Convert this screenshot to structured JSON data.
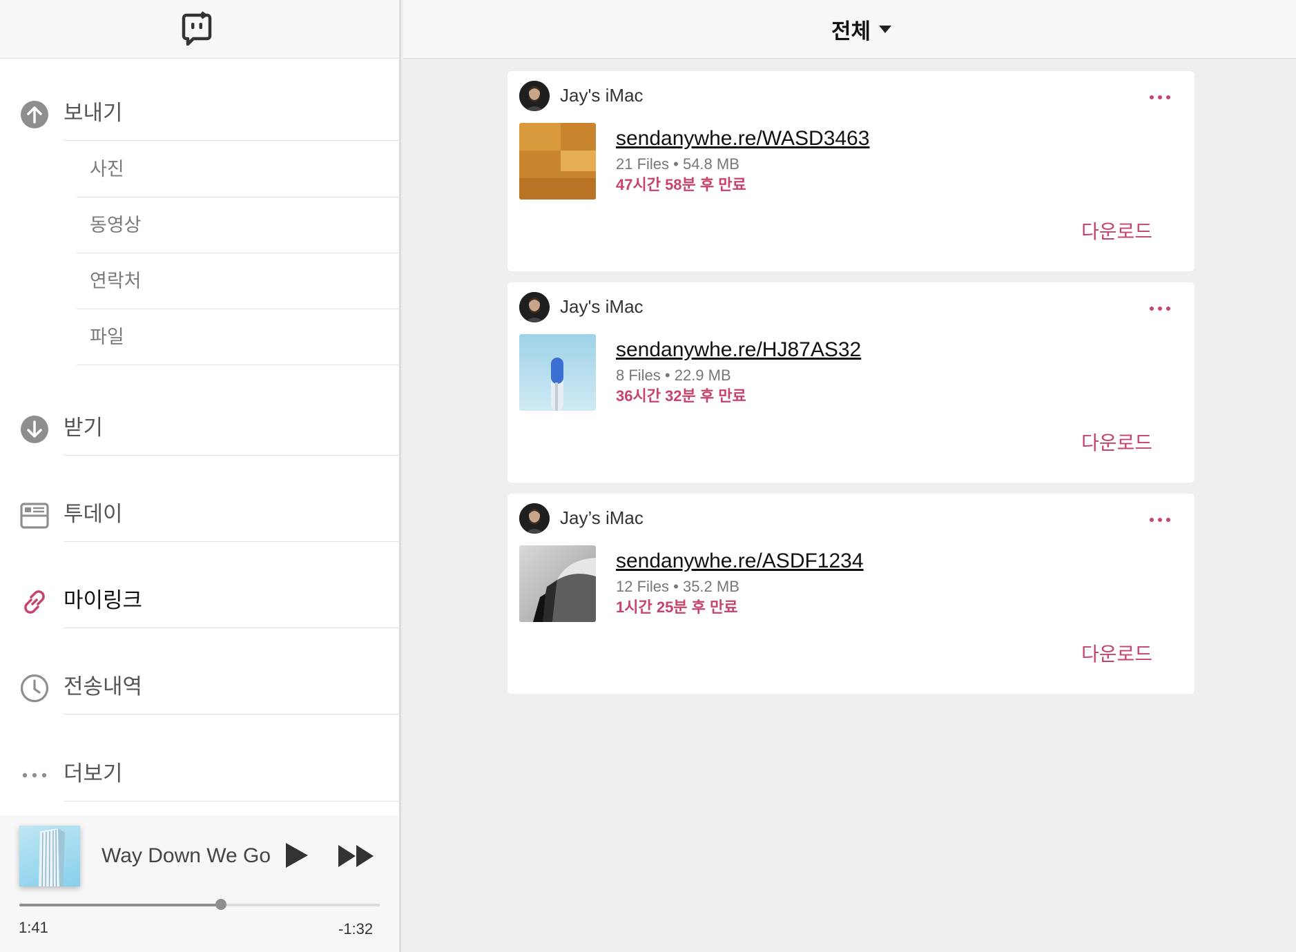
{
  "sidebar": {
    "send_label": "보내기",
    "send_items": [
      {
        "label": "사진"
      },
      {
        "label": "동영상"
      },
      {
        "label": "연락처"
      },
      {
        "label": "파일"
      }
    ],
    "receive_label": "받기",
    "today_label": "투데이",
    "mylink_label": "마이링크",
    "history_label": "전송내역",
    "more_label": "더보기"
  },
  "player": {
    "track_title": "Way Down We Go",
    "elapsed": "1:41",
    "remaining": "-1:32",
    "progress_fraction": 0.56
  },
  "main": {
    "filter_label": "전체",
    "cards": [
      {
        "device": "Jay's iMac",
        "link": "sendanywhe.re/WASD3463",
        "meta": "21 Files • 54.8 MB",
        "expiry": "47시간 58분 후 만료",
        "download": "다운로드"
      },
      {
        "device": "Jay's iMac",
        "link": "sendanywhe.re/HJ87AS32",
        "meta": "8 Files • 22.9 MB",
        "expiry": "36시간 32분 후 만료",
        "download": "다운로드"
      },
      {
        "device": "Jay’s iMac",
        "link": "sendanywhe.re/ASDF1234",
        "meta": "12 Files • 35.2 MB",
        "expiry": "1시간 25분 후 만료",
        "download": "다운로드"
      }
    ]
  },
  "colors": {
    "accent": "#c8436a",
    "icon_gray": "#8e8e8e"
  }
}
